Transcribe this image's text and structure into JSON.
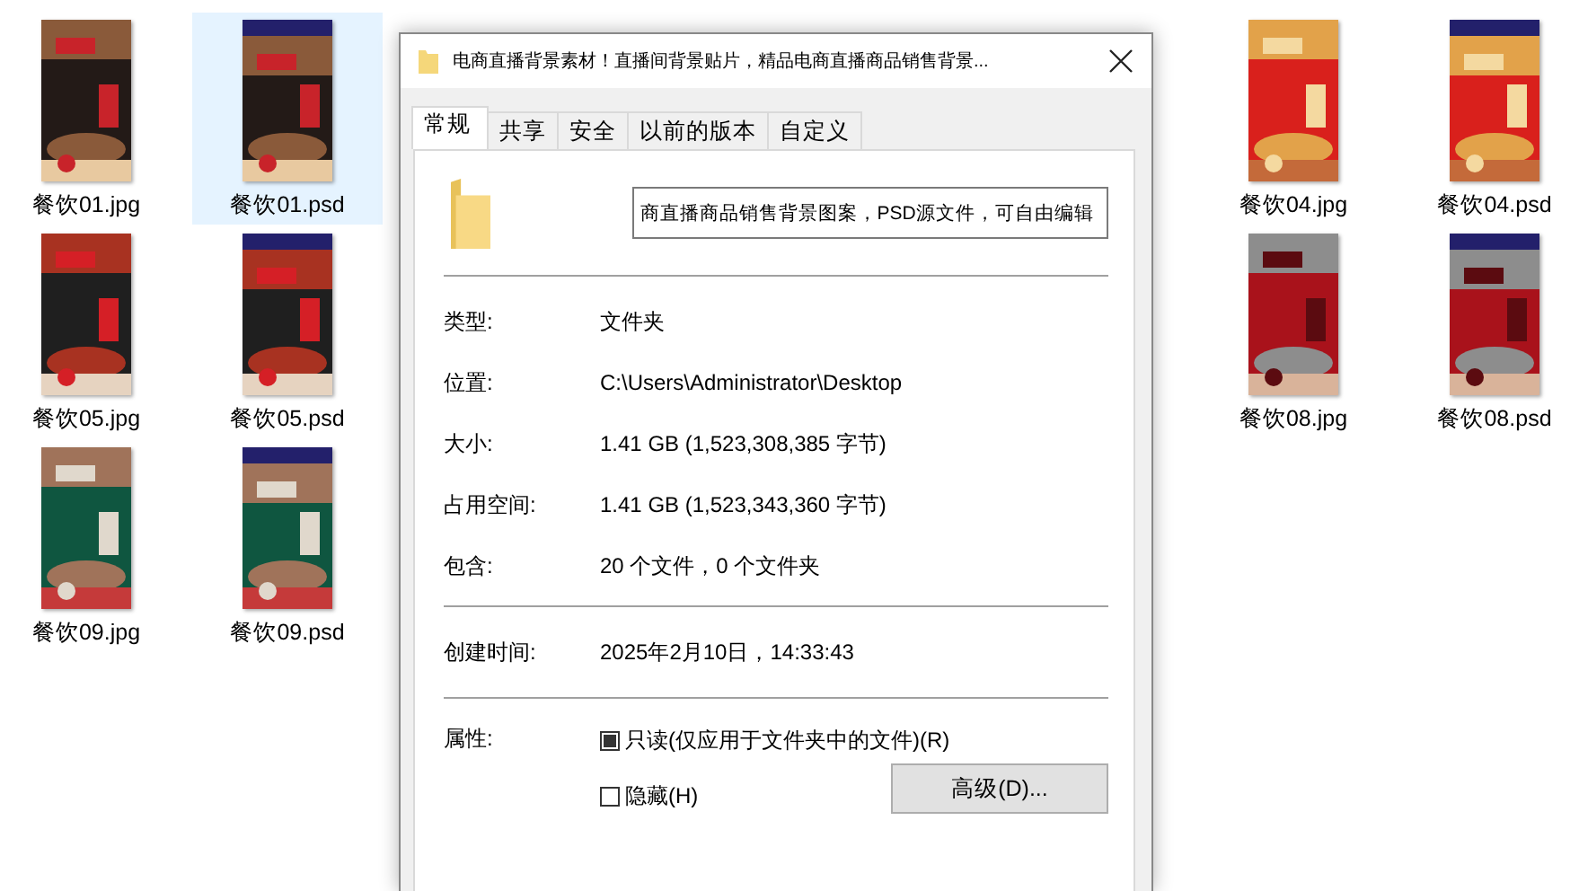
{
  "desktop": {
    "files": [
      {
        "label": "餐饮01.jpg",
        "kind": "jpg",
        "selected": false
      },
      {
        "label": "餐饮01.psd",
        "kind": "psd",
        "selected": true
      },
      {
        "label": "餐饮04.jpg",
        "kind": "jpg",
        "selected": false
      },
      {
        "label": "餐饮04.psd",
        "kind": "psd",
        "selected": false
      },
      {
        "label": "餐饮05.jpg",
        "kind": "jpg",
        "selected": false
      },
      {
        "label": "餐饮05.psd",
        "kind": "psd",
        "selected": false
      },
      {
        "label": "餐饮08.jpg",
        "kind": "jpg",
        "selected": false
      },
      {
        "label": "餐饮08.psd",
        "kind": "psd",
        "selected": false
      },
      {
        "label": "餐饮09.jpg",
        "kind": "jpg",
        "selected": false
      },
      {
        "label": "餐饮09.psd",
        "kind": "psd",
        "selected": false
      }
    ]
  },
  "dialog": {
    "title": "电商直播背景素材！直播间背景贴片，精品电商直播商品销售背景...",
    "tabs": [
      {
        "label": "常规",
        "selected": true
      },
      {
        "label": "共享",
        "selected": false
      },
      {
        "label": "安全",
        "selected": false
      },
      {
        "label": "以前的版本",
        "selected": false
      },
      {
        "label": "自定义",
        "selected": false
      }
    ],
    "name_field": {
      "value": "商直播商品销售背景图案，PSD源文件，可自由编辑"
    },
    "details": [
      {
        "label": "类型:",
        "value": "文件夹"
      },
      {
        "label": "位置:",
        "value": "C:\\Users\\Administrator\\Desktop"
      },
      {
        "label": "大小:",
        "value": "1.41 GB (1,523,308,385 字节)"
      },
      {
        "label": "占用空间:",
        "value": "1.41 GB (1,523,343,360 字节)"
      },
      {
        "label": "包含:",
        "value": "20 个文件，0 个文件夹"
      }
    ],
    "created": {
      "label": "创建时间:",
      "value": "2025年2月10日，14:33:43"
    },
    "attributes": {
      "label": "属性:",
      "options": [
        {
          "label": "只读(仅应用于文件夹中的文件)(R)",
          "checked": false,
          "indeterminate": true
        },
        {
          "label": "隐藏(H)",
          "checked": false,
          "indeterminate": false
        }
      ],
      "advanced_button": "高级(D)..."
    }
  }
}
